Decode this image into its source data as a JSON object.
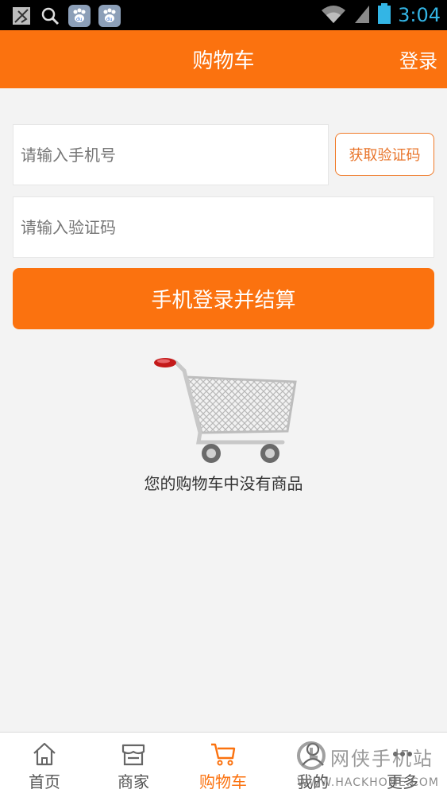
{
  "status_bar": {
    "time": "3:04",
    "left_icons": [
      "no-sim-icon",
      "search-icon",
      "baidu-icon",
      "baidu-icon"
    ],
    "right_icons": [
      "wifi-icon",
      "signal-icon",
      "battery-icon"
    ]
  },
  "header": {
    "title": "购物车",
    "login_label": "登录"
  },
  "form": {
    "phone_placeholder": "请输入手机号",
    "get_code_label": "获取验证码",
    "code_placeholder": "请输入验证码",
    "submit_label": "手机登录并结算"
  },
  "empty_cart": {
    "message": "您的购物车中没有商品"
  },
  "tabs": [
    {
      "label": "首页",
      "icon": "home-icon",
      "active": false
    },
    {
      "label": "商家",
      "icon": "store-icon",
      "active": false
    },
    {
      "label": "购物车",
      "icon": "cart-icon",
      "active": true
    },
    {
      "label": "我的",
      "icon": "user-icon",
      "active": false
    },
    {
      "label": "更多",
      "icon": "more-icon",
      "active": false
    }
  ],
  "watermark": {
    "text": "网侠手机站",
    "url": "WWW.HACKHOME.COM"
  },
  "colors": {
    "accent": "#fb720f",
    "status_blue": "#33b5e5",
    "background": "#f3f3f3"
  }
}
